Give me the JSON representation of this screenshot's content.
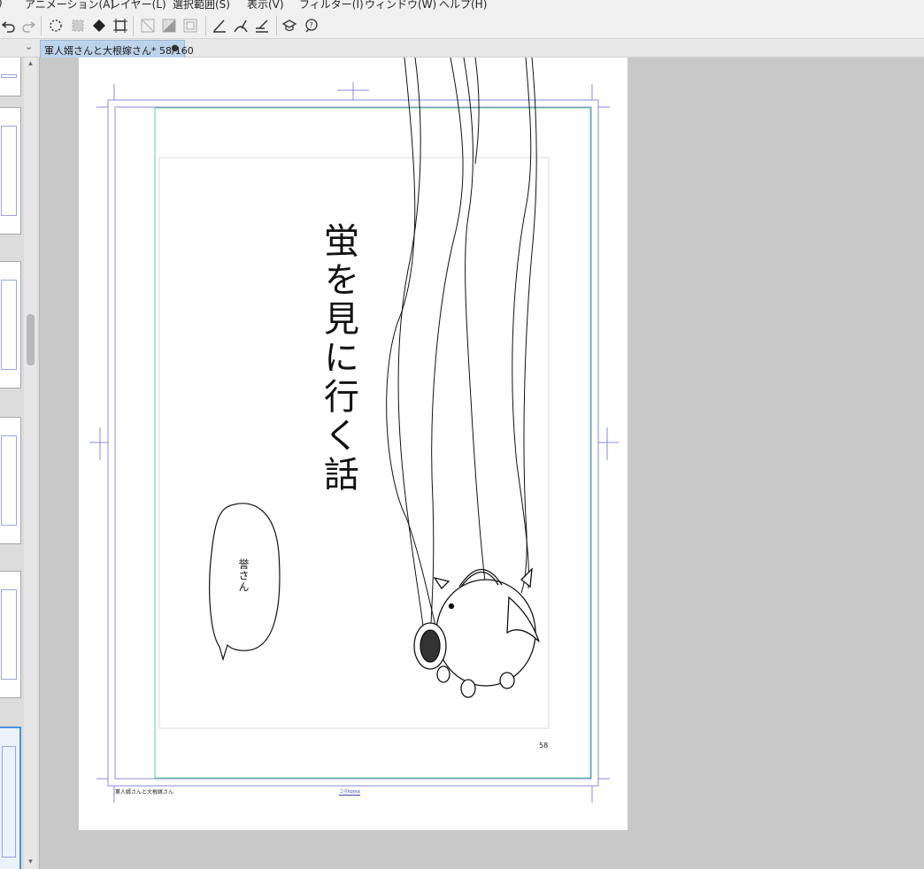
{
  "menu": {
    "items": [
      {
        "label": ")"
      },
      {
        "label": "アニメーション(A)"
      },
      {
        "label": "レイヤー(L)"
      },
      {
        "label": "選択範囲(S)"
      },
      {
        "label": "表示(V)"
      },
      {
        "label": "フィルター(I)"
      },
      {
        "label": "ウィンドウ(W)"
      },
      {
        "label": "ヘルプ(H)"
      }
    ]
  },
  "toolbar": {
    "icons": [
      "undo-icon",
      "redo-icon",
      "select-all-icon",
      "deselect-icon",
      "fill-icon",
      "transform-icon",
      "clear-icon",
      "clear-outside-icon",
      "frame-icon",
      "ruler-draw-icon",
      "ruler-curve-icon",
      "ruler-edit-icon",
      "settings-icon",
      "help-icon"
    ]
  },
  "tabs": {
    "document_label": "軍人婿さんと大根嫁さん* 58/160",
    "modified_dot": "●"
  },
  "pagestrip": {
    "up_arrow": "▴",
    "down_arrow": "▾"
  },
  "page": {
    "title": "蛍を見に行く話",
    "bubble_text": "誉さん",
    "page_number": "58",
    "footer_title": "軍人婿さんと大根嫁さん",
    "footer_center": "コマkoma"
  },
  "colors": {
    "tab_active": "#bcd3ea",
    "frame_outer": "#8a8ad8",
    "frame_inner": "#5fd08a",
    "canvas_bg": "#c8c8c8"
  }
}
